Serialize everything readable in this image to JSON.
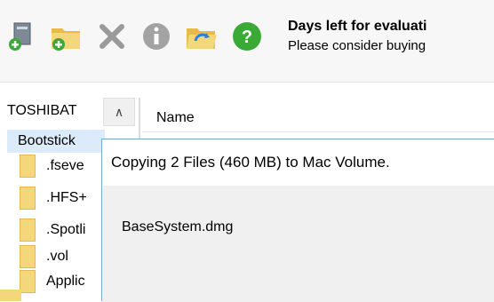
{
  "toolbar": {
    "icons": [
      {
        "name": "add-file-icon"
      },
      {
        "name": "add-folder-icon"
      },
      {
        "name": "delete-icon"
      },
      {
        "name": "info-icon"
      },
      {
        "name": "open-folder-icon"
      },
      {
        "name": "help-icon"
      }
    ]
  },
  "evaluation": {
    "title": "Days left for evaluati",
    "subtitle": "Please consider buying"
  },
  "tree": {
    "drive_label": "TOSHIBAT",
    "volume_label": "Bootstick",
    "items": [
      ".fseve",
      ".HFS+",
      ".Spotli",
      ".vol",
      "Applic"
    ]
  },
  "list": {
    "column_name": "Name"
  },
  "dialog": {
    "title": "Copying 2 Files (460 MB) to Mac Volume.",
    "current_file": "BaseSystem.dmg"
  },
  "colors": {
    "accent": "#7aa7d8",
    "folder": "#f4d77a",
    "selection": "#dcebfa",
    "help_green": "#3aa935",
    "delete_gray": "#9a9a9a"
  }
}
